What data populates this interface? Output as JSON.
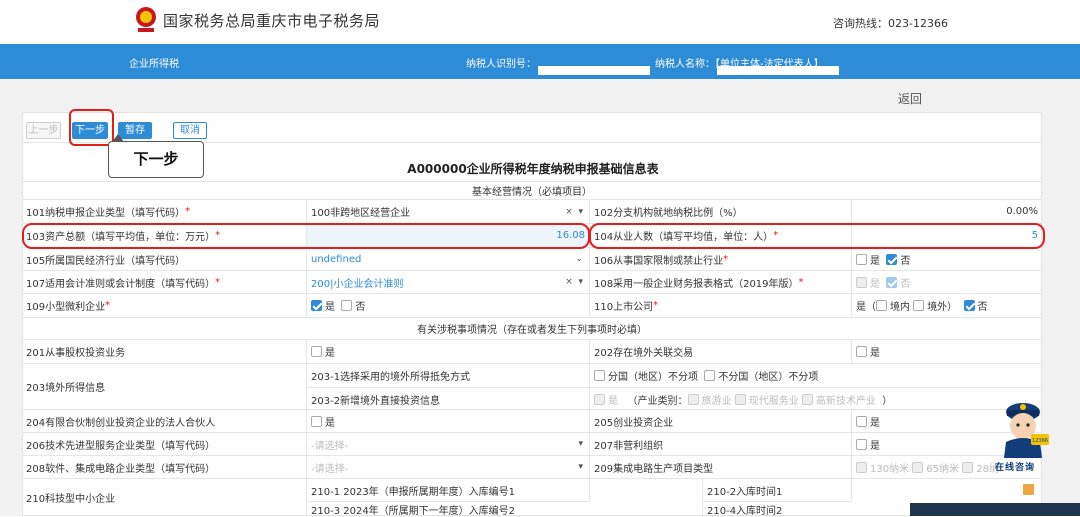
{
  "header": {
    "site_title": "国家税务总局重庆市电子税务局",
    "hotline": "咨询热线：023-12366"
  },
  "nav": {
    "module": "企业所得税",
    "taxpayer_id_label": "纳税人识别号：",
    "taxpayer_name_label": "纳税人名称：",
    "role": "【单位主体-法定代表人】"
  },
  "back": "返回",
  "toolbar": {
    "prev": "上一步",
    "next": "下一步",
    "save": "暂存",
    "cancel": "取消"
  },
  "callout": "下一步",
  "form": {
    "title": "A000000企业所得税年度纳税申报基础信息表",
    "section1": "基本经营情况（必填项目）",
    "section2": "有关涉税事项情况（存在或者发生下列事项时必填）",
    "r101_label": "101纳税申报企业类型（填写代码）",
    "r101_value": "100非跨地区经营企业",
    "r102_label": "102分支机构就地纳税比例（%）",
    "r102_value": "0.00%",
    "r103_label": "103资产总额（填写平均值，单位：万元）",
    "r103_value": "16.08",
    "r104_label": "104从业人数（填写平均值，单位：人）",
    "r104_value": "5",
    "r105_label": "105所属国民经济行业（填写代码）",
    "r105_value": "undefined",
    "r106_label": "106从事国家限制或禁止行业",
    "r107_label": "107适用会计准则或会计制度（填写代码）",
    "r107_value": "200|小企业会计准则",
    "r108_label": "108采用一般企业财务报表格式（2019年版）",
    "r109_label": "109小型微利企业",
    "r110_label": "110上市公司",
    "yes": "是",
    "no": "否",
    "yes_open": "是（",
    "domestic": "境内",
    "overseas": "境外）",
    "r201_label": "201从事股权投资业务",
    "r202_label": "202存在境外关联交易",
    "r203_label": "203境外所得信息",
    "r203_1_label": "203-1选择采用的境外所得抵免方式",
    "r203_1_opt1": "分国（地区）不分项",
    "r203_1_opt2": "不分国（地区）不分项",
    "r203_2_label": "203-2新增境外直接投资信息",
    "r203_2_industry": "（产业类别：",
    "r203_2_opt1": "旅游业",
    "r203_2_opt2": "现代服务业",
    "r203_2_opt3": "高新技术产业",
    "r203_2_close": "）",
    "r204_label": "204有限合伙制创业投资企业的法人合伙人",
    "r205_label": "205创业投资企业",
    "r206_label": "206技术先进型服务企业类型（填写代码）",
    "r206_placeholder": "-请选择-",
    "r207_label": "207非营利组织",
    "r208_label": "208软件、集成电路企业类型（填写代码）",
    "r208_placeholder": "-请选择-",
    "r209_label": "209集成电路生产项目类型",
    "r209_opt1": "130纳米",
    "r209_opt2": "65纳米",
    "r209_opt3": "28纳",
    "r210_label": "210科技型中小企业",
    "r210_1_label": "210-1    2023年（申报所属期年度）入库编号1",
    "r210_2_label": "210-2入库时间1",
    "r210_3_label": "210-3    2024年（所属期下一年度）入库编号2",
    "r210_4_label": "210-4入库时间2"
  },
  "mascot_label": "在线咨询",
  "mascot_badge": "12366",
  "colors": {
    "brand_blue": "#2e8cd6",
    "highlight_red": "#e0201c"
  }
}
